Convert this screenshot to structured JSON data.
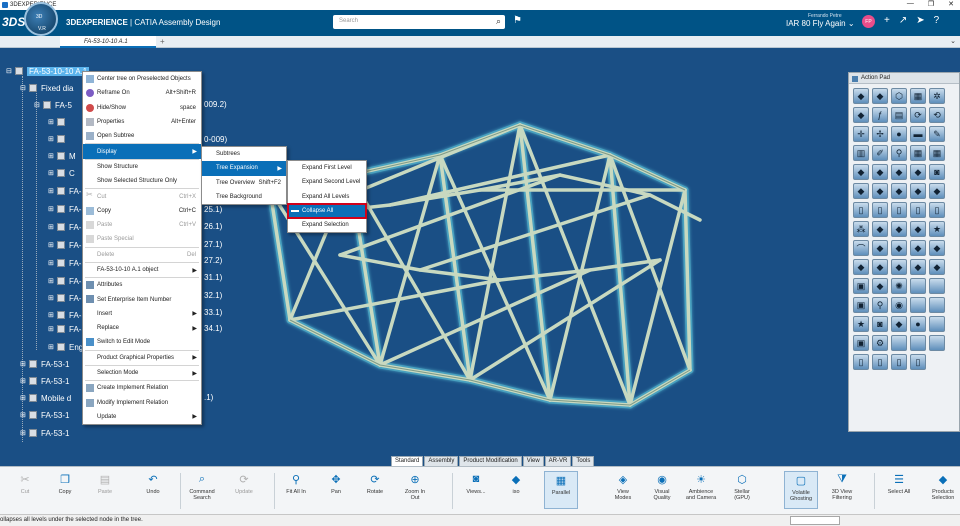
{
  "window": {
    "title": "3DEXPERIENCE"
  },
  "header": {
    "ds_logo": "3DS",
    "compass_top": "3D",
    "compass_bottom": "V.R",
    "brand_bold": "3DEXPERIENCE",
    "brand_sep": " | ",
    "brand_app": "CATIA Assembly Design",
    "search_placeholder": "Search",
    "user_name": "Ferrando Petre",
    "context": "IAR 80 Fly Again",
    "avatar": "FP"
  },
  "tabs": {
    "active": "FA-53-10-10 A.1",
    "add": "+"
  },
  "tree": {
    "root": "FA-53-10-10 A.1",
    "rows": [
      "Fixed dia",
      "FA-5",
      "",
      "",
      "M",
      "C",
      "FA-5",
      "FA-5",
      "FA-5",
      "FA-5",
      "FA-5",
      "FA-5",
      "FA-5",
      "FA-5",
      "FA-5",
      "Engin",
      "FA-53-1",
      "FA-53-1",
      "Mobile d",
      "FA-53-1",
      "FA-53-1"
    ],
    "suffixes": [
      "009.2)",
      "0-009)",
      "25.1)",
      "26.1)",
      "27.1)",
      "27.2)",
      "31.1)",
      "32.1)",
      "33.1)",
      "34.1)",
      ".1)"
    ]
  },
  "context_menu": {
    "items": [
      {
        "label": "Center tree on Preselected Objects",
        "shortcut": ""
      },
      {
        "label": "Reframe On",
        "shortcut": "Alt+Shift+R"
      },
      {
        "label": "Hide/Show",
        "shortcut": "space"
      },
      {
        "label": "Properties",
        "shortcut": "Alt+Enter"
      },
      {
        "label": "Open Subtree",
        "shortcut": ""
      },
      {
        "label": "Display",
        "shortcut": ""
      },
      {
        "label": "Show Structure",
        "shortcut": ""
      },
      {
        "label": "Show Selected Structure Only",
        "shortcut": ""
      },
      {
        "label": "Cut",
        "shortcut": "Ctrl+X"
      },
      {
        "label": "Copy",
        "shortcut": "Ctrl+C"
      },
      {
        "label": "Paste",
        "shortcut": "Ctrl+V"
      },
      {
        "label": "Paste Special",
        "shortcut": ""
      },
      {
        "label": "Delete",
        "shortcut": "Del"
      },
      {
        "label": "FA-53-10-10 A.1 object",
        "shortcut": ""
      },
      {
        "label": "Attributes",
        "shortcut": ""
      },
      {
        "label": "Set Enterprise Item Number",
        "shortcut": ""
      },
      {
        "label": "Insert",
        "shortcut": ""
      },
      {
        "label": "Replace",
        "shortcut": ""
      },
      {
        "label": "Switch to Edit Mode",
        "shortcut": ""
      },
      {
        "label": "Product Graphical Properties",
        "shortcut": ""
      },
      {
        "label": "Selection Mode",
        "shortcut": ""
      },
      {
        "label": "Create Implement Relation",
        "shortcut": ""
      },
      {
        "label": "Modify Implement Relation",
        "shortcut": ""
      },
      {
        "label": "Update",
        "shortcut": ""
      }
    ]
  },
  "display_submenu": {
    "items": [
      {
        "label": "Subtrees",
        "shortcut": ""
      },
      {
        "label": "Tree Expansion",
        "shortcut": ""
      },
      {
        "label": "Tree Overview",
        "shortcut": "Shift+F2"
      },
      {
        "label": "Tree Background",
        "shortcut": ""
      }
    ]
  },
  "expansion_submenu": {
    "items": [
      "Expand First Level",
      "Expand Second Level",
      "Expand All Levels",
      "Collapse All",
      "Expand Selection"
    ]
  },
  "action_pad": {
    "title": "Action Pad"
  },
  "section_tabs": [
    "Standard",
    "Assembly",
    "Product Modification",
    "View",
    "AR-VR",
    "Tools"
  ],
  "toolbar": {
    "cut": "Cut",
    "copy": "Copy",
    "paste": "Paste",
    "undo": "Undo",
    "command_search": "Command Search",
    "update": "Update",
    "fit_all_in": "Fit All In",
    "pan": "Pan",
    "rotate": "Rotate",
    "zoom_in_out": "Zoom In Out",
    "views": "Views...",
    "iso": "iso",
    "parallel": "Parallel",
    "view_modes": "View Modes",
    "visual_quality": "Visual Quality",
    "ambience_and_camera": "Ambience and Camera",
    "stellar_gpu": "Stellar (GPU)",
    "volatile_ghosting": "Volatile Ghosting",
    "3d_view_filtering": "3D View Filtering",
    "select_all": "Select All",
    "products_selection": "Products Selection"
  },
  "status": {
    "message": "ollapses all levels under the selected node in the tree."
  },
  "colors": {
    "viewport": "#1a4f85",
    "header": "#005386",
    "selection": "#5ab3ec",
    "highlight_box": "#d0021b"
  }
}
